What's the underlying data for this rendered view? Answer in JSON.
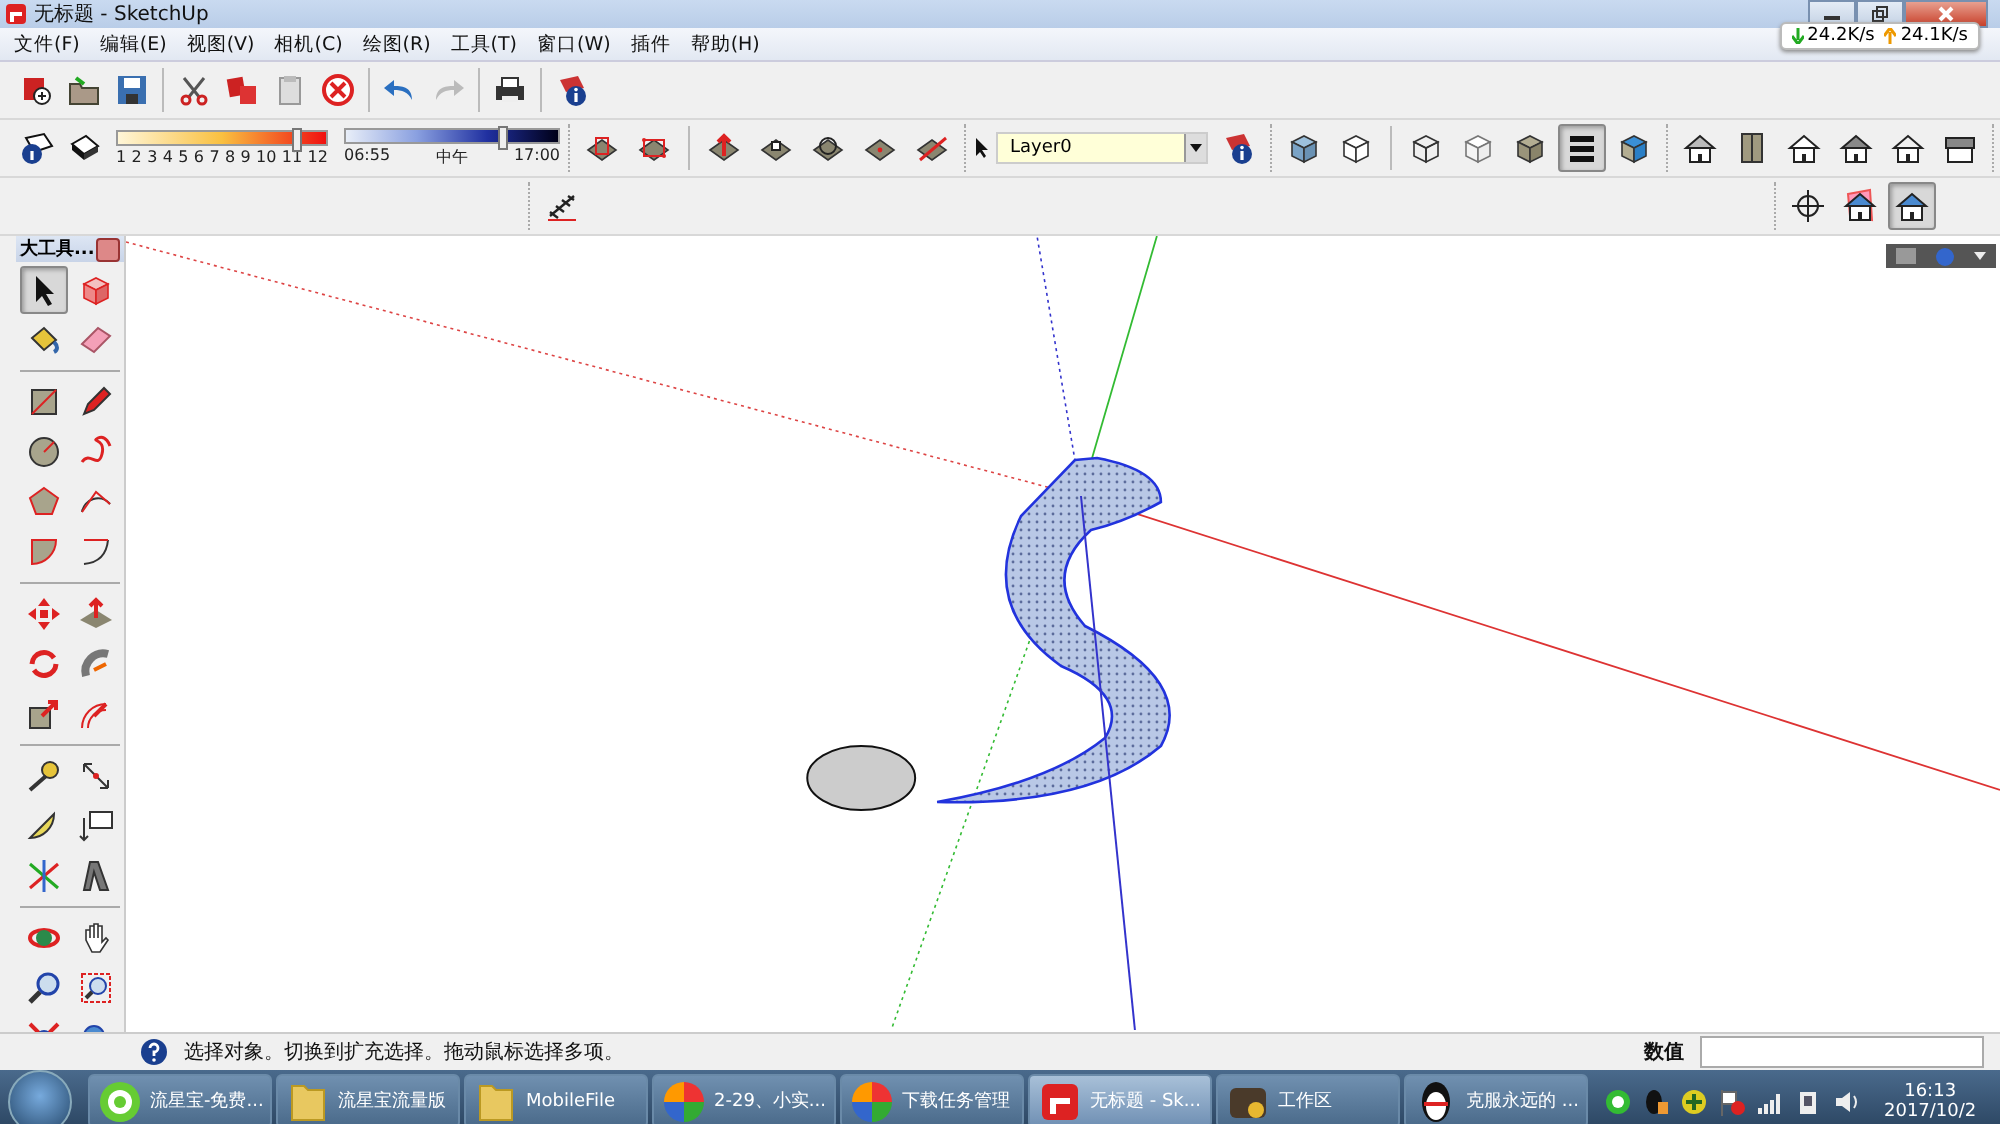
{
  "window": {
    "title": "无标题 - SketchUp"
  },
  "menu_bar": [
    "文件(F)",
    "编辑(E)",
    "视图(V)",
    "相机(C)",
    "绘图(R)",
    "工具(T)",
    "窗口(W)",
    "插件",
    "帮助(H)"
  ],
  "network_speed": {
    "download": "24.2K/s",
    "upload": "24.1K/s"
  },
  "shadow_settings": {
    "month_slider": {
      "labels": [
        "1",
        "2",
        "3",
        "4",
        "5",
        "6",
        "7",
        "8",
        "9",
        "10",
        "11",
        "12"
      ],
      "level": 0.84
    },
    "time_slider": {
      "start": "06:55",
      "mid": "中午",
      "end": "17:00",
      "level": 0.72
    }
  },
  "layers": {
    "current": "Layer0"
  },
  "style_buttons": [
    {
      "selected": false
    },
    {
      "selected": false
    },
    {
      "selected": false
    },
    {
      "selected": false
    },
    {
      "selected": false
    },
    {
      "selected": true
    },
    {
      "selected": false
    }
  ],
  "camera_buttons": [
    {
      "selected": false
    },
    {
      "selected": false
    },
    {
      "selected": true
    }
  ],
  "tool_palette": {
    "title": "大工具...",
    "tools": [
      {
        "selected": true
      },
      {
        "selected": false
      },
      {
        "selected": false
      },
      {
        "selected": false
      },
      {
        "selected": false
      },
      {
        "selected": false
      },
      {
        "selected": false
      },
      {
        "selected": false
      },
      {
        "selected": false
      },
      {
        "selected": false
      },
      {
        "selected": false
      },
      {
        "selected": false
      },
      {
        "selected": false
      },
      {
        "selected": false
      },
      {
        "selected": false
      },
      {
        "selected": false
      },
      {
        "selected": false
      },
      {
        "selected": false
      },
      {
        "selected": false
      },
      {
        "selected": false
      },
      {
        "selected": false
      },
      {
        "selected": false
      },
      {
        "selected": false
      },
      {
        "selected": false
      },
      {
        "selected": false
      },
      {
        "selected": false
      },
      {
        "selected": false
      },
      {
        "selected": false
      },
      {
        "selected": false
      },
      {
        "selected": false
      }
    ]
  },
  "status_bar": {
    "message": "选择对象。切换到扩充选择。拖动鼠标选择多项。",
    "measurements_label": "数值"
  },
  "taskbar": {
    "items": [
      {
        "label": "流星宝-免费...",
        "selected": false
      },
      {
        "label": "流星宝流量版",
        "selected": false
      },
      {
        "label": "MobileFile",
        "selected": false
      },
      {
        "label": "2-29、小实...",
        "selected": false
      },
      {
        "label": "下载任务管理",
        "selected": false
      },
      {
        "label": "无标题 - Sk...",
        "selected": true
      },
      {
        "label": "工作区",
        "selected": false
      },
      {
        "label": "克服永远的 ...",
        "selected": false
      }
    ],
    "time": "16:13",
    "date": "2017/10/2"
  }
}
